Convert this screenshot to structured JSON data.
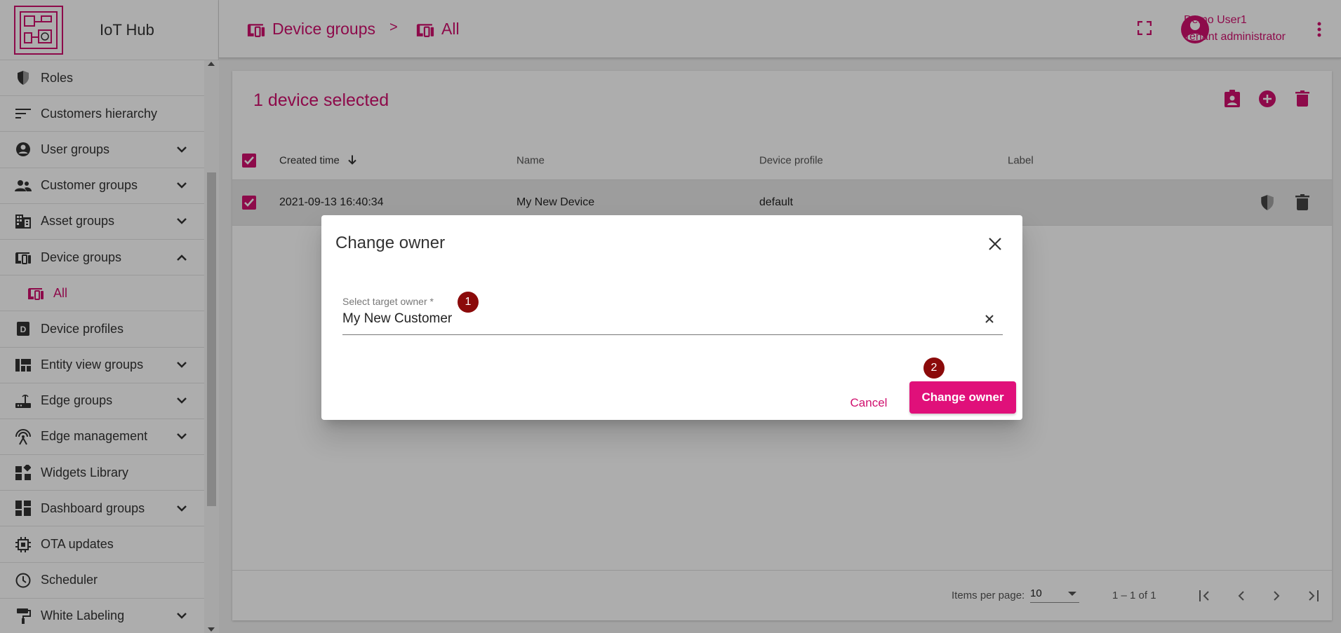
{
  "app": {
    "title": "IoT Hub"
  },
  "sidebar": {
    "items": [
      {
        "label": "Roles",
        "icon": "shield-icon"
      },
      {
        "label": "Customers hierarchy",
        "icon": "sort-icon"
      },
      {
        "label": "User groups",
        "icon": "account-circle-icon",
        "expandable": true
      },
      {
        "label": "Customer groups",
        "icon": "supervisor-account-icon",
        "expandable": true
      },
      {
        "label": "Asset groups",
        "icon": "domain-icon",
        "expandable": true
      },
      {
        "label": "Device groups",
        "icon": "devices-other-icon",
        "expanded": true
      },
      {
        "label": "All",
        "icon": "devices-other-icon",
        "sub": true
      },
      {
        "label": "Device profiles",
        "icon": "device-profile-icon"
      },
      {
        "label": "Entity view groups",
        "icon": "view-quilt-icon",
        "expandable": true
      },
      {
        "label": "Edge groups",
        "icon": "router-icon",
        "expandable": true
      },
      {
        "label": "Edge management",
        "icon": "settings-input-antenna-icon",
        "expandable": true
      },
      {
        "label": "Widgets Library",
        "icon": "widgets-icon"
      },
      {
        "label": "Dashboard groups",
        "icon": "dashboard-icon",
        "expandable": true
      },
      {
        "label": "OTA updates",
        "icon": "memory-icon"
      },
      {
        "label": "Scheduler",
        "icon": "schedule-icon"
      },
      {
        "label": "White Labeling",
        "icon": "format-paint-icon",
        "expandable": true
      }
    ]
  },
  "header": {
    "breadcrumb": [
      "Device groups",
      "All"
    ],
    "separator": ">",
    "user": {
      "name": "Demo User1",
      "role": "Tenant administrator"
    }
  },
  "main": {
    "selection_title": "1 device selected",
    "columns": [
      "Created time",
      "Name",
      "Device profile",
      "Label"
    ],
    "rows": [
      {
        "created": "2021-09-13 16:40:34",
        "name": "My New Device",
        "profile": "default",
        "label": ""
      }
    ],
    "paginator": {
      "items_per_page_label": "Items per page:",
      "items_per_page": "10",
      "range": "1 – 1 of 1"
    }
  },
  "dialog": {
    "title": "Change owner",
    "field_label": "Select target owner *",
    "field_value": "My New Customer",
    "cancel_label": "Cancel",
    "confirm_label": "Change owner",
    "badges": [
      "1",
      "2"
    ]
  },
  "colors": {
    "accent": "#d0106e",
    "badge": "#8b0a0a"
  }
}
